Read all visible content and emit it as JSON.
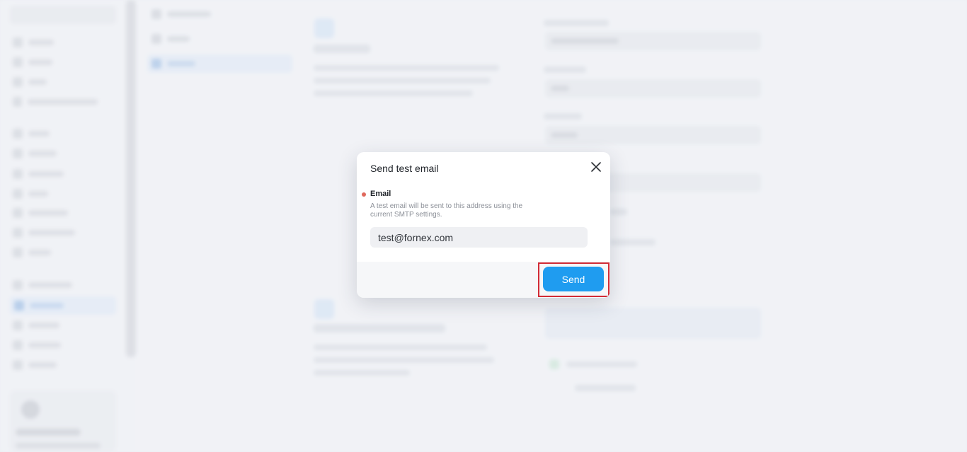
{
  "dialog": {
    "title": "Send test email",
    "field_label": "Email",
    "field_help": "A test email will be sent to this address using the current SMTP settings.",
    "email_value": "test@fornex.com",
    "send_label": "Send"
  },
  "colors": {
    "primary": "#1f9cf0",
    "required_dot": "#e0685c",
    "highlight_border": "#d22b36"
  },
  "icons": {
    "close": "close-icon"
  }
}
